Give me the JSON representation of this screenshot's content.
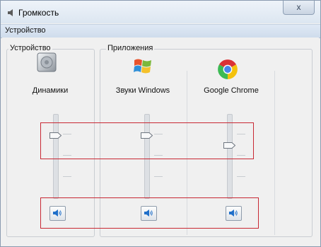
{
  "window": {
    "title": "Громкость",
    "close_glyph": "x"
  },
  "menu": {
    "items": [
      {
        "label": "Устройство"
      }
    ]
  },
  "groups": {
    "device": {
      "title": "Устройство"
    },
    "apps": {
      "title": "Приложения"
    }
  },
  "channels": [
    {
      "label": "Динамики",
      "icon": "speaker-device-icon",
      "level_percent": 75,
      "muted": false
    },
    {
      "label": "Звуки Windows",
      "icon": "windows-logo-icon",
      "level_percent": 75,
      "muted": false
    },
    {
      "label": "Google Chrome",
      "icon": "chrome-logo-icon",
      "level_percent": 63,
      "muted": false
    }
  ],
  "colors": {
    "highlight_box": "#c82833",
    "window_border": "#8a9bb0"
  }
}
